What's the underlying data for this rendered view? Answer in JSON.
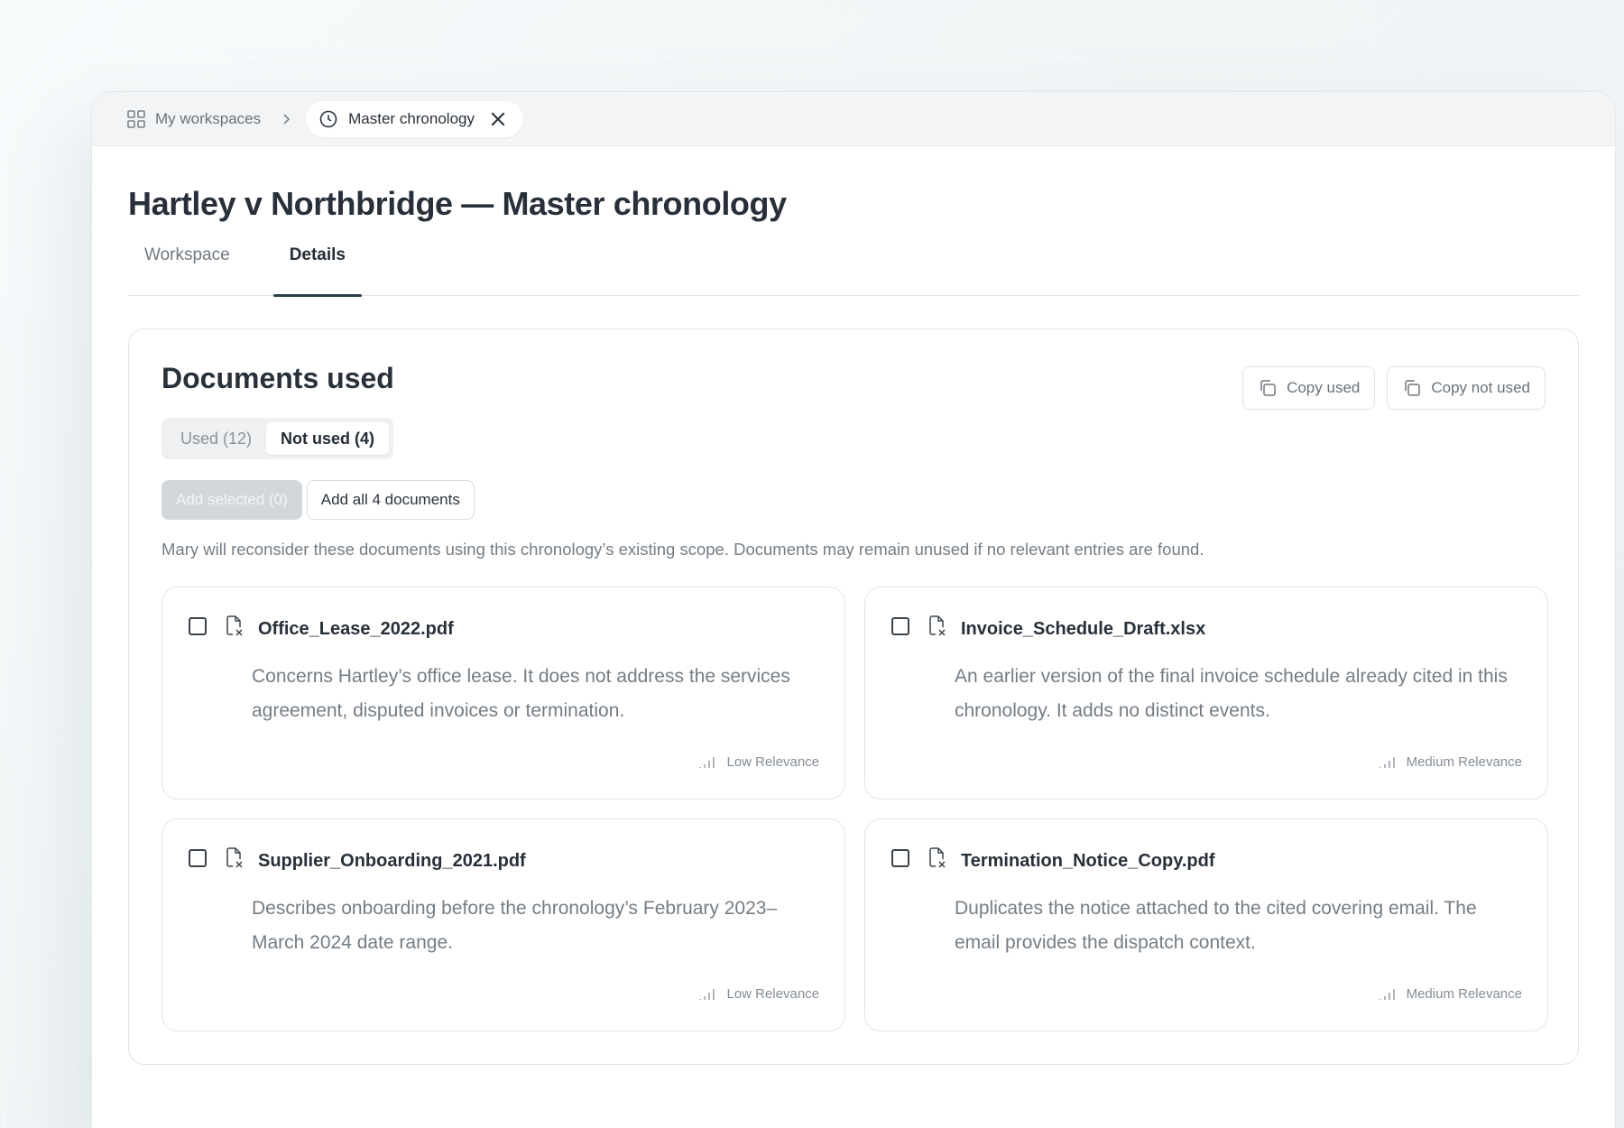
{
  "breadcrumb": {
    "workspaces_label": "My workspaces",
    "active_tab_label": "Master chronology"
  },
  "page": {
    "title": "Hartley v Northbridge — Master chronology",
    "tabs": [
      {
        "label": "Workspace",
        "active": false
      },
      {
        "label": "Details",
        "active": true
      }
    ]
  },
  "documents": {
    "title": "Documents used",
    "copy_used_label": "Copy used",
    "copy_not_used_label": "Copy not used",
    "segments": [
      {
        "label": "Used (12)",
        "active": false
      },
      {
        "label": "Not used (4)",
        "active": true
      }
    ],
    "add_selected_label": "Add selected (0)",
    "add_all_label": "Add all 4 documents",
    "note": "Mary will reconsider these documents using this chronology’s existing scope. Documents may remain unused if no relevant entries are found.",
    "items": [
      {
        "name": "Office_Lease_2022.pdf",
        "description": "Concerns Hartley’s office lease. It does not address the services agreement, disputed invoices or termination.",
        "relevance": "Low Relevance"
      },
      {
        "name": "Invoice_Schedule_Draft.xlsx",
        "description": "An earlier version of the final invoice schedule already cited in this chronology. It adds no distinct events.",
        "relevance": "Medium Relevance"
      },
      {
        "name": "Supplier_Onboarding_2021.pdf",
        "description": "Describes onboarding before the chronology’s February 2023–March 2024 date range.",
        "relevance": "Low Relevance"
      },
      {
        "name": "Termination_Notice_Copy.pdf",
        "description": "Duplicates the notice attached to the cited covering email. The email provides the dispatch context.",
        "relevance": "Medium Relevance"
      }
    ]
  },
  "colors": {
    "accent_underline": "#2b4048",
    "text_primary": "#27303a",
    "text_muted": "#747d85",
    "disabled_button": "#d3d7da"
  }
}
